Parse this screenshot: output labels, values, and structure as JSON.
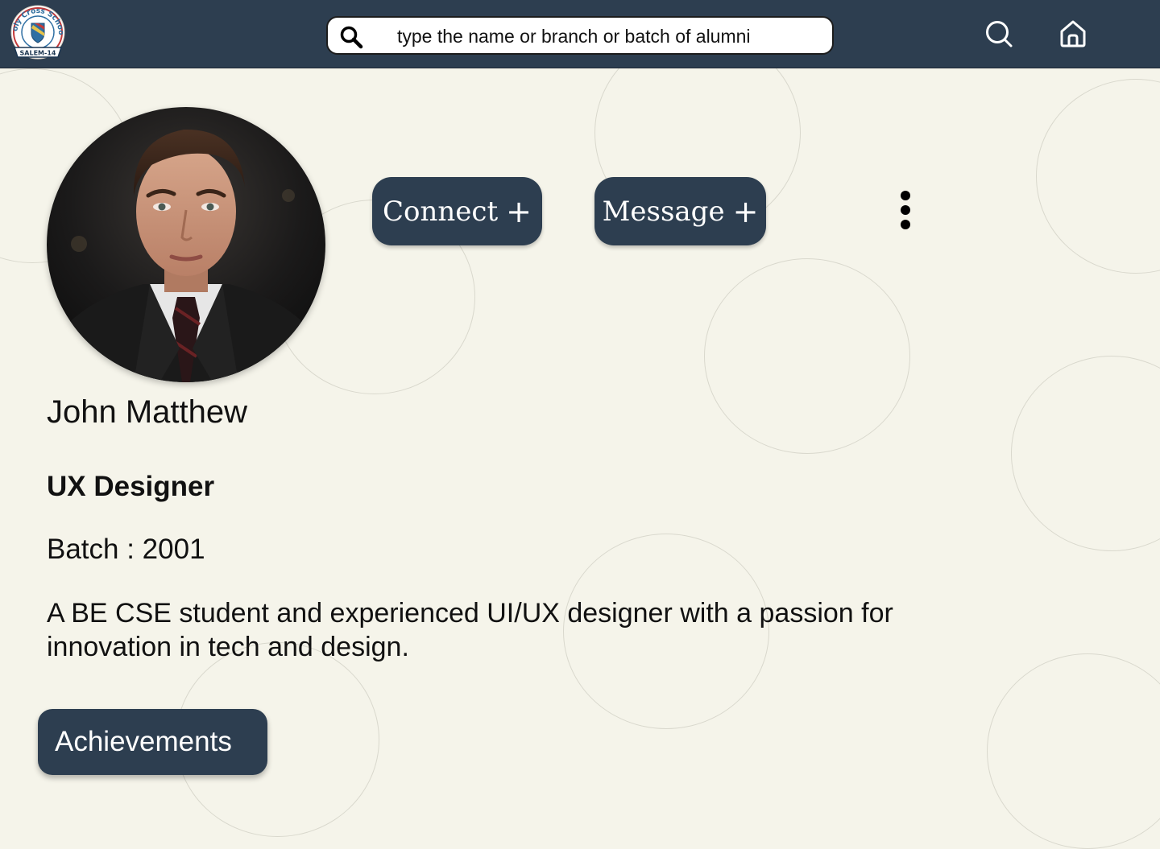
{
  "header": {
    "logo": {
      "ring_text": "Holy Cross School",
      "ribbon_text": "SALEM-14"
    },
    "search": {
      "placeholder": "type the name or branch or batch of alumni"
    },
    "nav": {
      "search_icon": "search-icon",
      "home_icon": "home-icon"
    }
  },
  "profile": {
    "name": "John Matthew",
    "role": "UX Designer",
    "batch": "Batch : 2001",
    "bio": "A BE CSE student and experienced UI/UX designer with a passion for innovation in tech and design."
  },
  "actions": {
    "connect_label": "Connect",
    "message_label": "Message",
    "plus_glyph": "+",
    "more_icon": "more-vertical-icon"
  },
  "achievements_label": "Achievements",
  "colors": {
    "primary": "#2d3e50",
    "background": "#f5f4ea",
    "text": "#111111",
    "button_text": "#ffffff"
  }
}
